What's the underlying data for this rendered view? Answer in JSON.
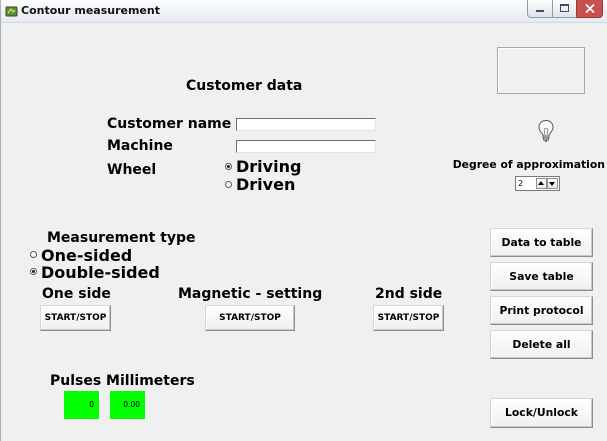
{
  "window": {
    "title": "Contour measurement"
  },
  "customer": {
    "heading": "Customer data",
    "name": {
      "label": "Customer name",
      "value": ""
    },
    "machine": {
      "label": "Machine",
      "value": ""
    },
    "wheel": {
      "label": "Wheel",
      "options": [
        {
          "label": "Driving",
          "selected": true
        },
        {
          "label": "Driven",
          "selected": false
        }
      ]
    }
  },
  "approximation": {
    "label": "Degree of approximation",
    "value": "2"
  },
  "measurement_type": {
    "label": "Measurement type",
    "options": [
      {
        "label": "One-sided",
        "selected": false
      },
      {
        "label": "Double-sided",
        "selected": true
      }
    ]
  },
  "sections": {
    "one_side": {
      "label": "One side",
      "button": "START/STOP"
    },
    "magnetic": {
      "label": "Magnetic - setting",
      "button": "START/STOP"
    },
    "second_side": {
      "label": "2nd side",
      "button": "START/STOP"
    }
  },
  "actions": {
    "data_to_table": "Data to table",
    "save_table": "Save table",
    "print_protocol": "Print protocol",
    "delete_all": "Delete all",
    "lock_unlock": "Lock/Unlock"
  },
  "counters": {
    "label": "Pulses Millimeters",
    "pulses": "0",
    "millimeters": "0.00"
  },
  "icons": {
    "app": "app-icon",
    "minimize": "minimize-icon",
    "maximize": "maximize-icon",
    "close": "close-icon",
    "indicator": "lightbulb-icon",
    "spin_up": "arrow-up-icon",
    "spin_down": "arrow-down-icon"
  },
  "colors": {
    "background": "#f0f0f0",
    "counter_fill": "#00ff00",
    "close_button": "#c75050"
  }
}
